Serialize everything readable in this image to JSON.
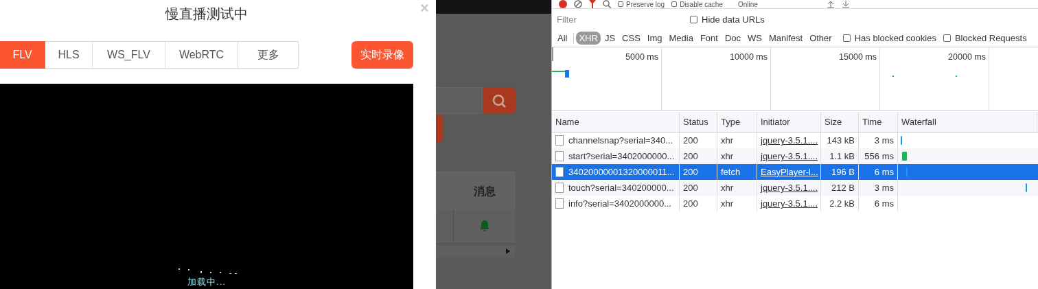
{
  "dialog": {
    "title": "慢直播测试中",
    "close": "×",
    "tabs": [
      {
        "label": "FLV",
        "selected": true
      },
      {
        "label": "HLS",
        "selected": false
      },
      {
        "label": "WS_FLV",
        "selected": false
      },
      {
        "label": "WebRTC",
        "selected": false
      },
      {
        "label": "更多",
        "selected": false
      }
    ],
    "record_button": "实时录像",
    "video": {
      "status": "加载中..."
    }
  },
  "background_page": {
    "table_header": "消息"
  },
  "devtools": {
    "toolbar": {
      "preserve_log": {
        "label": "Preserve log",
        "checked": false
      },
      "disable_cache": {
        "label": "Disable cache",
        "checked": false
      },
      "throttling": "Online"
    },
    "filter": {
      "placeholder": "Filter"
    },
    "hide_data_urls": {
      "label": "Hide data URLs",
      "checked": false
    },
    "types": [
      {
        "label": "All",
        "selected": false
      },
      {
        "label": "XHR",
        "selected": true
      },
      {
        "label": "JS",
        "selected": false
      },
      {
        "label": "CSS",
        "selected": false
      },
      {
        "label": "Img",
        "selected": false
      },
      {
        "label": "Media",
        "selected": false
      },
      {
        "label": "Font",
        "selected": false
      },
      {
        "label": "Doc",
        "selected": false
      },
      {
        "label": "WS",
        "selected": false
      },
      {
        "label": "Manifest",
        "selected": false
      },
      {
        "label": "Other",
        "selected": false
      }
    ],
    "has_blocked_cookies": {
      "label": "Has blocked cookies",
      "checked": false
    },
    "blocked_requests": {
      "label": "Blocked Requests",
      "checked": false
    },
    "overview_ticks": [
      "5000 ms",
      "10000 ms",
      "15000 ms",
      "20000 ms"
    ],
    "columns": [
      "Name",
      "Status",
      "Type",
      "Initiator",
      "Size",
      "Time",
      "Waterfall"
    ],
    "rows": [
      {
        "name": "channelsnap?serial=340...",
        "status": "200",
        "type": "xhr",
        "initiator": "jquery-3.5.1....",
        "size": "143 kB",
        "time": "3 ms",
        "selected": false,
        "color": "#1a9be6"
      },
      {
        "name": "start?serial=3402000000...",
        "status": "200",
        "type": "xhr",
        "initiator": "jquery-3.5.1....",
        "size": "1.1 kB",
        "time": "556 ms",
        "selected": false,
        "color": "#1fb45a"
      },
      {
        "name": "34020000001320000011...",
        "status": "200",
        "type": "fetch",
        "initiator": "EasyPlayer-l...",
        "size": "196 B",
        "time": "6 ms",
        "selected": true,
        "color": "#1a9be6"
      },
      {
        "name": "touch?serial=340200000...",
        "status": "200",
        "type": "xhr",
        "initiator": "jquery-3.5.1....",
        "size": "212 B",
        "time": "3 ms",
        "selected": false,
        "color": "#1a9be6"
      },
      {
        "name": "info?serial=3402000000...",
        "status": "200",
        "type": "xhr",
        "initiator": "jquery-3.5.1....",
        "size": "2.2 kB",
        "time": "6 ms",
        "selected": false
      }
    ]
  }
}
